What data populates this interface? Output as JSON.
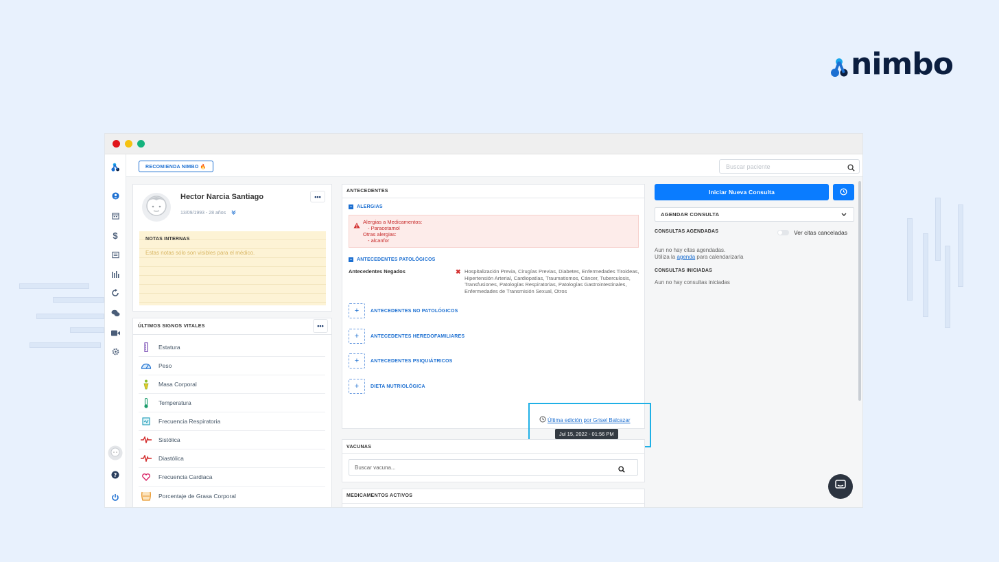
{
  "brand": {
    "name": "nimbo"
  },
  "window": {
    "dots": [
      "#e0151b",
      "#f5c211",
      "#14b37d"
    ]
  },
  "topbar": {
    "recommend_label": "RECOMIENDA NIMBO 🔥",
    "search_placeholder": "Buscar paciente"
  },
  "sidebar": {
    "icons": [
      "logo-icon",
      "user-icon",
      "calendar-icon",
      "dollar-icon",
      "list-icon",
      "chart-icon",
      "refresh-icon",
      "chat-icon",
      "video-icon",
      "settings-icon",
      "avatar-icon",
      "help-icon",
      "power-icon"
    ]
  },
  "patient": {
    "name": "Hector Narcia Santiago",
    "info": "13/09/1993 - 28 años",
    "more": "•••",
    "notes_title": "NOTAS INTERNAS",
    "notes_placeholder": "Estas notas sólo son visibles para el médico."
  },
  "vitals": {
    "title": "ÚLTIMOS SIGNOS VITALES",
    "more": "•••",
    "items": [
      {
        "label": "Estatura",
        "icon": "height-icon",
        "color": "#7b4fb6"
      },
      {
        "label": "Peso",
        "icon": "scale-icon",
        "color": "#1c6fd1"
      },
      {
        "label": "Masa Corporal",
        "icon": "body-mass-icon",
        "color": "#8bbf2a"
      },
      {
        "label": "Temperatura",
        "icon": "thermometer-icon",
        "color": "#1a9c6b"
      },
      {
        "label": "Frecuencia Respiratoria",
        "icon": "lungs-icon",
        "color": "#1b9bb8"
      },
      {
        "label": "Sistólica",
        "icon": "pulse-icon",
        "color": "#d32f2f"
      },
      {
        "label": "Diastólica",
        "icon": "pulse-icon",
        "color": "#d32f2f"
      },
      {
        "label": "Frecuencia Cardiaca",
        "icon": "heart-icon",
        "color": "#d81b60"
      },
      {
        "label": "Porcentaje de Grasa Corporal",
        "icon": "body-fat-icon",
        "color": "#e8962a"
      }
    ]
  },
  "antecedentes": {
    "title": "ANTECEDENTES",
    "alergias_label": "ALERGIAS",
    "alert_lines": [
      "Alergias a Medicamentos:",
      "- Paracetamol",
      "Otras alergias:",
      "- alcanfor"
    ],
    "patologicos_label": "ANTECEDENTES PATOLÓGICOS",
    "negados_label": "Antecedentes Negados",
    "negados_text": "Hospitalización Previa, Cirugías Previas, Diabetes, Enfermedades Tiroideas, Hipertensión Arterial, Cardiopatías, Traumatismos, Cáncer, Tuberculosis, Transfusiones, Patologías Respiratorias, Patologías Gastrointestinales, Enfermedades de Transmisión Sexual, Otros",
    "sections": [
      "ANTECEDENTES NO PATOLÓGICOS",
      "ANTECEDENTES HEREDOFAMILIARES",
      "ANTECEDENTES PSIQUIÁTRICOS",
      "DIETA NUTRIOLÓGICA"
    ],
    "last_edit": "Última edición por Grisel Balcazar",
    "tooltip": "Jul 15, 2022 - 01:56 PM"
  },
  "vacunas": {
    "title": "VACUNAS",
    "placeholder": "Buscar vacuna..."
  },
  "medicamentos": {
    "title": "MEDICAMENTOS ACTIVOS"
  },
  "right": {
    "start_button": "Iniciar Nueva Consulta",
    "agendar_label": "AGENDAR CONSULTA",
    "agendadas_title": "CONSULTAS AGENDADAS",
    "ver_canceladas": "Ver citas canceladas",
    "no_citas_1": "Aun no hay citas agendadas.",
    "no_citas_2a": "Utiliza la ",
    "no_citas_link": "agenda",
    "no_citas_2b": " para calendarizarla",
    "iniciadas_title": "CONSULTAS INICIADAS",
    "no_iniciadas": "Aun no hay consultas iniciadas"
  },
  "colors": {
    "primary": "#0a7cff",
    "accent": "#1c6fd1",
    "alert": "#c62828",
    "brand_dark": "#0b1e3f"
  }
}
